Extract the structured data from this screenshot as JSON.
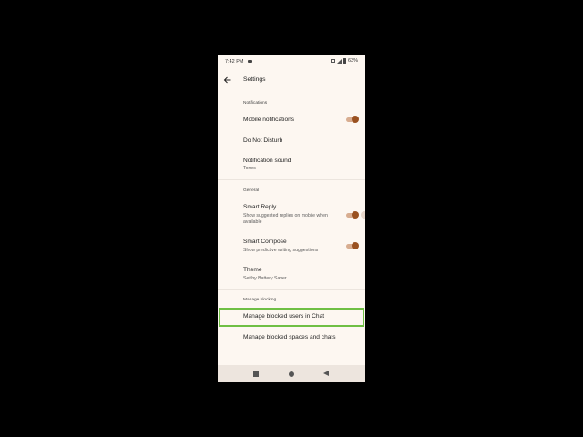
{
  "status_bar": {
    "time": "7:42 PM",
    "battery": "63%"
  },
  "app_bar": {
    "back_icon": "arrow-back-icon",
    "title": "Settings"
  },
  "sections": {
    "notifications": {
      "header": "Notifications",
      "mobile_notifications": {
        "title": "Mobile notifications",
        "enabled": true
      },
      "do_not_disturb": {
        "title": "Do Not Disturb"
      },
      "notification_sound": {
        "title": "Notification sound",
        "subtitle": "Tones"
      }
    },
    "general": {
      "header": "General",
      "smart_reply": {
        "title": "Smart Reply",
        "subtitle": "Show suggested replies on mobile when available",
        "enabled": true
      },
      "smart_compose": {
        "title": "Smart Compose",
        "subtitle": "Show predictive writing suggestions",
        "enabled": true
      },
      "theme": {
        "title": "Theme",
        "subtitle": "Set by Battery Saver"
      }
    },
    "manage_blocking": {
      "header": "Manage blocking",
      "blocked_users": {
        "title": "Manage blocked users in Chat"
      },
      "blocked_spaces": {
        "title": "Manage blocked spaces and chats"
      }
    }
  },
  "nav_bar": {
    "icons": [
      "recents-square-icon",
      "home-circle-icon",
      "back-triangle-icon"
    ]
  },
  "colors": {
    "background": "#fdf7f1",
    "toggle_thumb": "#9a5120",
    "toggle_track": "#d8ad90",
    "highlight": "#6fbf44"
  }
}
